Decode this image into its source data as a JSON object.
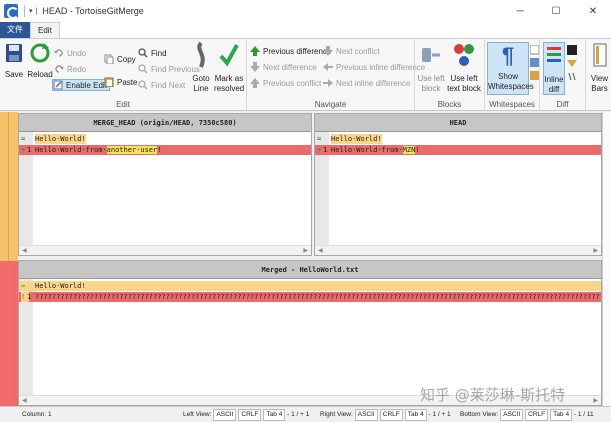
{
  "window": {
    "title": "HEAD - TortoiseGitMerge",
    "minimize": "─",
    "maximize": "☐",
    "close": "✕"
  },
  "tabs": {
    "file": "文件",
    "edit": "Edit"
  },
  "ribbon": {
    "save": "Save",
    "reload": "Reload",
    "undo": "Undo",
    "redo": "Redo",
    "enable_edit": "Enable Edit",
    "copy": "Copy",
    "paste": "Paste",
    "find": "Find",
    "find_previous": "Find Previous",
    "find_next": "Find Next",
    "goto_line_1": "Goto",
    "goto_line_2": "Line",
    "mark_resolved_1": "Mark as",
    "mark_resolved_2": "resolved",
    "edit_group": "Edit",
    "prev_difference": "Previous difference",
    "next_difference": "Next difference",
    "prev_conflict": "Previous conflict",
    "next_conflict": "Next conflict",
    "prev_inline": "Previous inline difference",
    "next_inline": "Next inline difference",
    "navigate_group": "Navigate",
    "use_left_block_1": "Use left",
    "use_left_block_2": "block",
    "use_left_text_1": "Use left",
    "use_left_text_2": "text block",
    "blocks_group": "Blocks",
    "show_ws_1": "Show",
    "show_ws_2": "Whitespaces",
    "whitespaces_group": "Whitespaces",
    "inline_diff_1": "Inline",
    "inline_diff_2": "diff",
    "diff_group": "Diff",
    "view_bars_1": "View",
    "view_bars_2": "Bars"
  },
  "left_pane": {
    "header": "MERGE_HEAD (origin/HEAD, 7350c580)",
    "lines": [
      {
        "marker": "=",
        "num": "",
        "text": "Hello·World!",
        "state": "equal"
      },
      {
        "marker": "+",
        "num": "1",
        "text_prefix": "Hello·World·from·",
        "text_changed": "another·user",
        "text_suffix": "!",
        "state": "added"
      }
    ]
  },
  "right_pane": {
    "header": "HEAD",
    "lines": [
      {
        "marker": "=",
        "num": "",
        "text": "Hello·World!",
        "state": "equal"
      },
      {
        "marker": "+",
        "num": "1",
        "text_prefix": "Hello·World·from·",
        "text_changed": "MZN",
        "text_suffix": "!",
        "state": "added"
      }
    ]
  },
  "bottom_pane": {
    "header": "Merged - HelloWorld.txt",
    "lines": [
      {
        "marker": "−",
        "num": "",
        "text": "Hello·World!",
        "state": "equal"
      },
      {
        "marker": "!",
        "num": "1",
        "text": "????????????????????????????????????????????????????????????????????????????????????????????????????????????????????????????????????????????",
        "state": "conflict"
      }
    ]
  },
  "status": {
    "column": "Column: 1",
    "left_view_label": "Left View:",
    "left_encoding": "ASCII",
    "left_eol": "CRLF",
    "left_tab": "Tab 4",
    "left_count": "- 1 / + 1",
    "right_view_label": "Right View:",
    "right_encoding": "ASCII",
    "right_eol": "CRLF",
    "right_tab": "Tab 4",
    "right_count": "- 1 / + 1",
    "bottom_view_label": "Bottom View:",
    "bottom_encoding": "ASCII",
    "bottom_eol": "CRLF",
    "bottom_tab": "Tab 4",
    "bottom_count": "- 1 / 11"
  },
  "watermark": "知乎 @莱莎琳-斯托特",
  "colors": {
    "equal": "#f9d58a",
    "conflict": "#ea6b6b",
    "accent": "#2b5797"
  }
}
